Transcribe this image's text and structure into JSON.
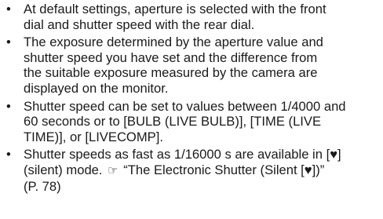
{
  "bullets": [
    {
      "marker": "•",
      "lines": [
        "At default settings, aperture is selected with the front",
        "dial and shutter speed with the rear dial."
      ]
    },
    {
      "marker": "•",
      "lines": [
        "The exposure determined by the aperture value and",
        "shutter speed you have set and the difference from",
        "the suitable exposure measured by the camera are",
        "displayed on the monitor."
      ]
    },
    {
      "marker": "•",
      "lines": [
        "Shutter speed can be set to values between 1/4000 and",
        "60 seconds or to [BULB (LIVE BULB)], [TIME (LIVE",
        "TIME)], or [LIVECOMP]."
      ]
    },
    {
      "marker": "•",
      "lines": [
        "Shutter speeds as fast as 1/16000 s are available in [♥]"
      ],
      "ref_line_before": "(silent) mode.",
      "ref_icon": "☞",
      "ref_line_after": "“The Electronic Shutter (Silent [♥])”",
      "last_line": "(P. 78)"
    }
  ],
  "icons": {
    "reference": "reference-pointer-icon"
  }
}
